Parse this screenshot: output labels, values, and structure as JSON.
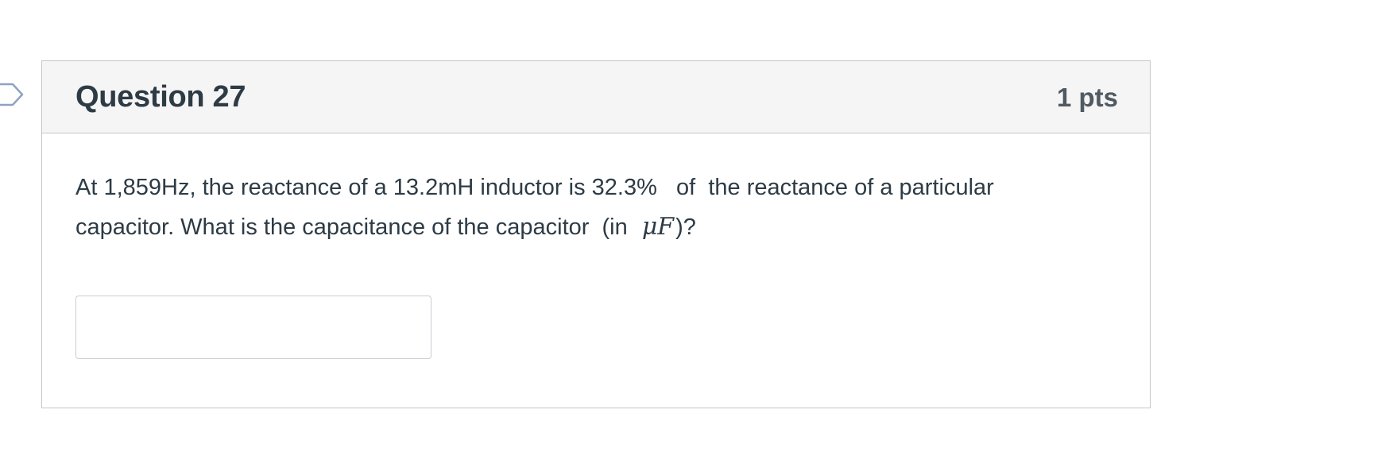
{
  "question": {
    "title": "Question 27",
    "points": "1 pts",
    "text_line1": "At 1,859Hz, the reactance of a 13.2mH inductor is 32.3%   of  the reactance of a particular",
    "text_line2_prefix": "capacitor. What is the capacitance of the capacitor  (in ",
    "unit_math": "μF",
    "text_line2_suffix": ")?",
    "answer_value": ""
  },
  "colors": {
    "header_bg": "#f5f5f5",
    "border": "#c3c7cb",
    "text": "#2d3b45",
    "points_text": "#4f5a62",
    "flag": "#8fa3c3"
  },
  "icons": {
    "flag": "bookmark-flag-icon"
  }
}
